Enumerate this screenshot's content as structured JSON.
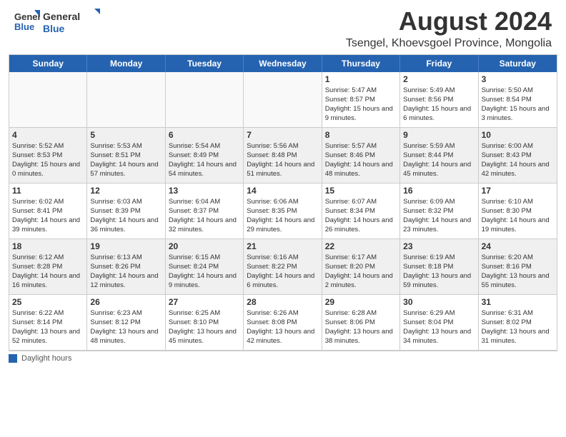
{
  "header": {
    "logo_general": "General",
    "logo_blue": "Blue",
    "month_title": "August 2024",
    "location": "Tsengel, Khoevsgoel Province, Mongolia"
  },
  "days_of_week": [
    "Sunday",
    "Monday",
    "Tuesday",
    "Wednesday",
    "Thursday",
    "Friday",
    "Saturday"
  ],
  "footer_label": "Daylight hours",
  "weeks": [
    [
      {
        "day": "",
        "sunrise": "",
        "sunset": "",
        "daylight": "",
        "empty": true
      },
      {
        "day": "",
        "sunrise": "",
        "sunset": "",
        "daylight": "",
        "empty": true
      },
      {
        "day": "",
        "sunrise": "",
        "sunset": "",
        "daylight": "",
        "empty": true
      },
      {
        "day": "",
        "sunrise": "",
        "sunset": "",
        "daylight": "",
        "empty": true
      },
      {
        "day": "1",
        "sunrise": "Sunrise: 5:47 AM",
        "sunset": "Sunset: 8:57 PM",
        "daylight": "Daylight: 15 hours and 9 minutes."
      },
      {
        "day": "2",
        "sunrise": "Sunrise: 5:49 AM",
        "sunset": "Sunset: 8:56 PM",
        "daylight": "Daylight: 15 hours and 6 minutes."
      },
      {
        "day": "3",
        "sunrise": "Sunrise: 5:50 AM",
        "sunset": "Sunset: 8:54 PM",
        "daylight": "Daylight: 15 hours and 3 minutes."
      }
    ],
    [
      {
        "day": "4",
        "sunrise": "Sunrise: 5:52 AM",
        "sunset": "Sunset: 8:53 PM",
        "daylight": "Daylight: 15 hours and 0 minutes.",
        "shaded": true
      },
      {
        "day": "5",
        "sunrise": "Sunrise: 5:53 AM",
        "sunset": "Sunset: 8:51 PM",
        "daylight": "Daylight: 14 hours and 57 minutes.",
        "shaded": true
      },
      {
        "day": "6",
        "sunrise": "Sunrise: 5:54 AM",
        "sunset": "Sunset: 8:49 PM",
        "daylight": "Daylight: 14 hours and 54 minutes.",
        "shaded": true
      },
      {
        "day": "7",
        "sunrise": "Sunrise: 5:56 AM",
        "sunset": "Sunset: 8:48 PM",
        "daylight": "Daylight: 14 hours and 51 minutes.",
        "shaded": true
      },
      {
        "day": "8",
        "sunrise": "Sunrise: 5:57 AM",
        "sunset": "Sunset: 8:46 PM",
        "daylight": "Daylight: 14 hours and 48 minutes.",
        "shaded": true
      },
      {
        "day": "9",
        "sunrise": "Sunrise: 5:59 AM",
        "sunset": "Sunset: 8:44 PM",
        "daylight": "Daylight: 14 hours and 45 minutes.",
        "shaded": true
      },
      {
        "day": "10",
        "sunrise": "Sunrise: 6:00 AM",
        "sunset": "Sunset: 8:43 PM",
        "daylight": "Daylight: 14 hours and 42 minutes.",
        "shaded": true
      }
    ],
    [
      {
        "day": "11",
        "sunrise": "Sunrise: 6:02 AM",
        "sunset": "Sunset: 8:41 PM",
        "daylight": "Daylight: 14 hours and 39 minutes."
      },
      {
        "day": "12",
        "sunrise": "Sunrise: 6:03 AM",
        "sunset": "Sunset: 8:39 PM",
        "daylight": "Daylight: 14 hours and 36 minutes."
      },
      {
        "day": "13",
        "sunrise": "Sunrise: 6:04 AM",
        "sunset": "Sunset: 8:37 PM",
        "daylight": "Daylight: 14 hours and 32 minutes."
      },
      {
        "day": "14",
        "sunrise": "Sunrise: 6:06 AM",
        "sunset": "Sunset: 8:35 PM",
        "daylight": "Daylight: 14 hours and 29 minutes."
      },
      {
        "day": "15",
        "sunrise": "Sunrise: 6:07 AM",
        "sunset": "Sunset: 8:34 PM",
        "daylight": "Daylight: 14 hours and 26 minutes."
      },
      {
        "day": "16",
        "sunrise": "Sunrise: 6:09 AM",
        "sunset": "Sunset: 8:32 PM",
        "daylight": "Daylight: 14 hours and 23 minutes."
      },
      {
        "day": "17",
        "sunrise": "Sunrise: 6:10 AM",
        "sunset": "Sunset: 8:30 PM",
        "daylight": "Daylight: 14 hours and 19 minutes."
      }
    ],
    [
      {
        "day": "18",
        "sunrise": "Sunrise: 6:12 AM",
        "sunset": "Sunset: 8:28 PM",
        "daylight": "Daylight: 14 hours and 16 minutes.",
        "shaded": true
      },
      {
        "day": "19",
        "sunrise": "Sunrise: 6:13 AM",
        "sunset": "Sunset: 8:26 PM",
        "daylight": "Daylight: 14 hours and 12 minutes.",
        "shaded": true
      },
      {
        "day": "20",
        "sunrise": "Sunrise: 6:15 AM",
        "sunset": "Sunset: 8:24 PM",
        "daylight": "Daylight: 14 hours and 9 minutes.",
        "shaded": true
      },
      {
        "day": "21",
        "sunrise": "Sunrise: 6:16 AM",
        "sunset": "Sunset: 8:22 PM",
        "daylight": "Daylight: 14 hours and 6 minutes.",
        "shaded": true
      },
      {
        "day": "22",
        "sunrise": "Sunrise: 6:17 AM",
        "sunset": "Sunset: 8:20 PM",
        "daylight": "Daylight: 14 hours and 2 minutes.",
        "shaded": true
      },
      {
        "day": "23",
        "sunrise": "Sunrise: 6:19 AM",
        "sunset": "Sunset: 8:18 PM",
        "daylight": "Daylight: 13 hours and 59 minutes.",
        "shaded": true
      },
      {
        "day": "24",
        "sunrise": "Sunrise: 6:20 AM",
        "sunset": "Sunset: 8:16 PM",
        "daylight": "Daylight: 13 hours and 55 minutes.",
        "shaded": true
      }
    ],
    [
      {
        "day": "25",
        "sunrise": "Sunrise: 6:22 AM",
        "sunset": "Sunset: 8:14 PM",
        "daylight": "Daylight: 13 hours and 52 minutes."
      },
      {
        "day": "26",
        "sunrise": "Sunrise: 6:23 AM",
        "sunset": "Sunset: 8:12 PM",
        "daylight": "Daylight: 13 hours and 48 minutes."
      },
      {
        "day": "27",
        "sunrise": "Sunrise: 6:25 AM",
        "sunset": "Sunset: 8:10 PM",
        "daylight": "Daylight: 13 hours and 45 minutes."
      },
      {
        "day": "28",
        "sunrise": "Sunrise: 6:26 AM",
        "sunset": "Sunset: 8:08 PM",
        "daylight": "Daylight: 13 hours and 42 minutes."
      },
      {
        "day": "29",
        "sunrise": "Sunrise: 6:28 AM",
        "sunset": "Sunset: 8:06 PM",
        "daylight": "Daylight: 13 hours and 38 minutes."
      },
      {
        "day": "30",
        "sunrise": "Sunrise: 6:29 AM",
        "sunset": "Sunset: 8:04 PM",
        "daylight": "Daylight: 13 hours and 34 minutes."
      },
      {
        "day": "31",
        "sunrise": "Sunrise: 6:31 AM",
        "sunset": "Sunset: 8:02 PM",
        "daylight": "Daylight: 13 hours and 31 minutes."
      }
    ]
  ]
}
